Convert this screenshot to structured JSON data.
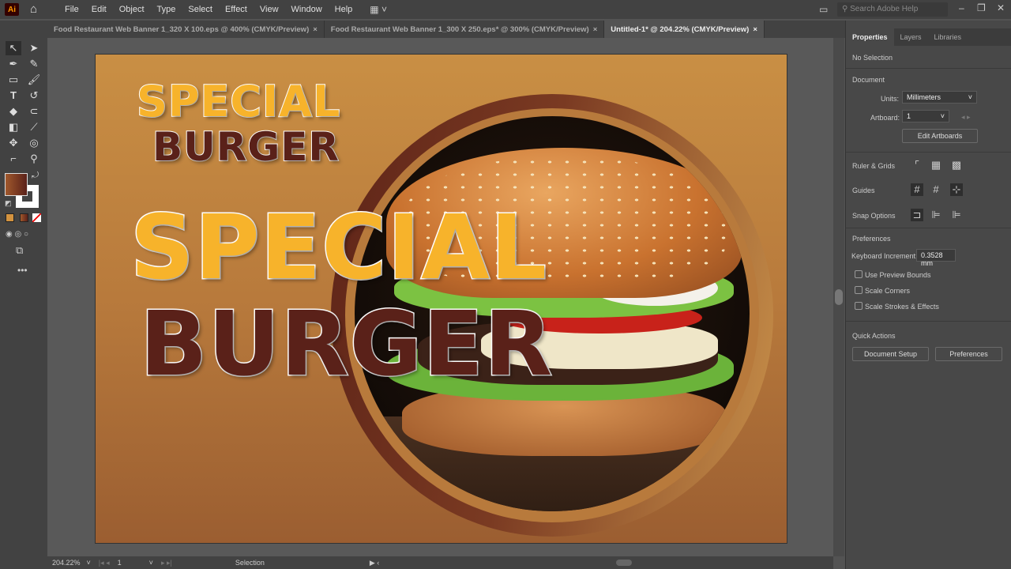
{
  "app": {
    "logo": "Ai",
    "menu": [
      "File",
      "Edit",
      "Object",
      "Type",
      "Select",
      "Effect",
      "View",
      "Window",
      "Help"
    ],
    "search_placeholder": "Search Adobe Help"
  },
  "tabs": [
    {
      "label": "Food Restaurant Web Banner 1_320 X 100.eps @ 400% (CMYK/Preview)",
      "active": false
    },
    {
      "label": "Food Restaurant Web Banner 1_300 X 250.eps* @ 300% (CMYK/Preview)",
      "active": false
    },
    {
      "label": "Untitled-1* @ 204.22% (CMYK/Preview)",
      "active": true
    }
  ],
  "artwork": {
    "small_line1": "SPECIAL",
    "small_line2": "BURGER",
    "big_line1": "SPECIAL",
    "big_line2": "BURGER",
    "colors": {
      "yellow": "#f7b32b",
      "brown": "#5a2119",
      "background_top": "#c98f44",
      "background_bottom": "#9b5e31"
    }
  },
  "status": {
    "zoom": "204.22%",
    "artboard": "1",
    "tool": "Selection"
  },
  "panel": {
    "tabs": [
      "Properties",
      "Layers",
      "Libraries"
    ],
    "selection": "No Selection",
    "document_heading": "Document",
    "units_label": "Units:",
    "units_value": "Millimeters",
    "artboard_label": "Artboard:",
    "artboard_value": "1",
    "edit_artboards": "Edit Artboards",
    "ruler_grids": "Ruler & Grids",
    "guides": "Guides",
    "snap_options": "Snap Options",
    "preferences_heading": "Preferences",
    "keyboard_increment_label": "Keyboard Increment:",
    "keyboard_increment_value": "0.3528 mm",
    "checkboxes": [
      "Use Preview Bounds",
      "Scale Corners",
      "Scale Strokes & Effects"
    ],
    "quick_actions": "Quick Actions",
    "document_setup": "Document Setup",
    "preferences_button": "Preferences"
  }
}
